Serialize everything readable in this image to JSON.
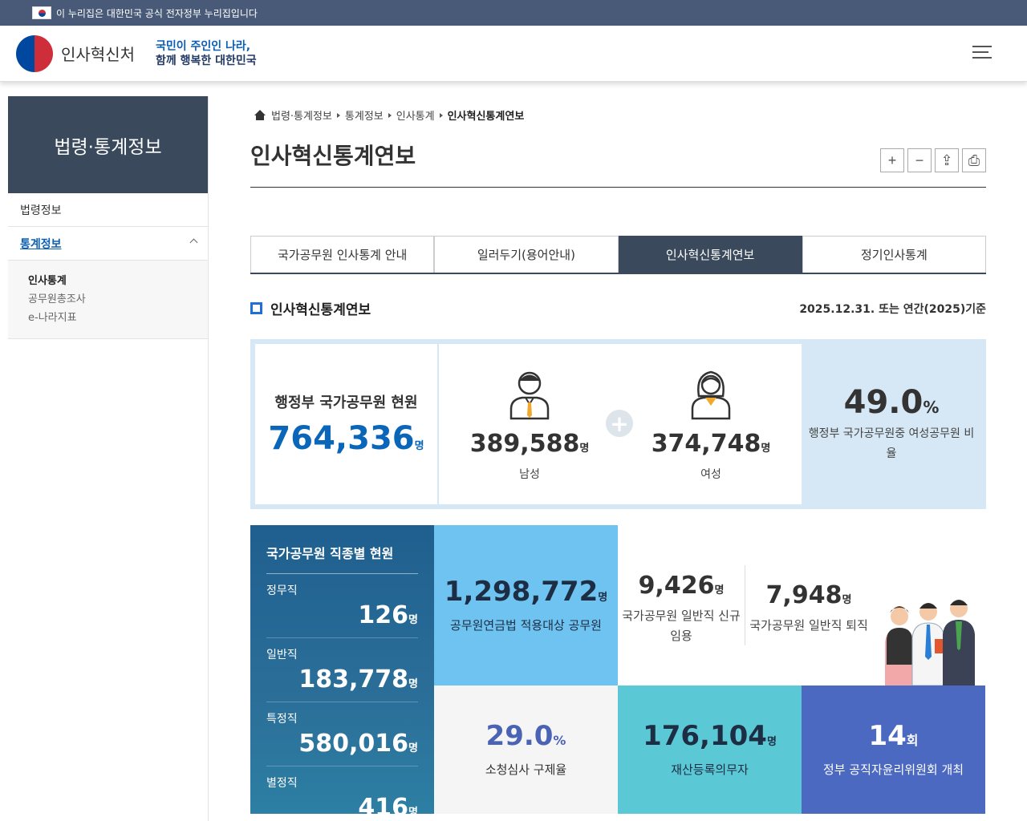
{
  "gov_banner": {
    "text": "이 누리집은 대한민국 공식 전자정부 누리집입니다"
  },
  "header": {
    "org_name": "인사혁신처",
    "slogan_line1": "국민이 주인인 나라,",
    "slogan_line2": "함께 행복한 대한민국"
  },
  "sidebar": {
    "title": "법령·통계정보",
    "items": [
      {
        "label": "법령정보"
      },
      {
        "label": "통계정보"
      }
    ],
    "sub_items": [
      {
        "label": "인사통계"
      },
      {
        "label": "공무원총조사"
      },
      {
        "label": "e-나라지표"
      }
    ]
  },
  "breadcrumb": [
    "법령·통계정보",
    "통계정보",
    "인사통계",
    "인사혁신통계연보"
  ],
  "page_title": "인사혁신통계연보",
  "tools": {
    "zoom_in": "+",
    "zoom_out": "−",
    "share": "⇪",
    "print": "⎙"
  },
  "tabs": [
    {
      "label": "국가공무원 인사통계 안내"
    },
    {
      "label": "일러두기(용어안내)"
    },
    {
      "label": "인사혁신통계연보",
      "active": true
    },
    {
      "label": "정기인사통계"
    }
  ],
  "section": {
    "title": "인사혁신통계연보",
    "date": "2025.12.31. 또는 연간(2025)기준"
  },
  "summary": {
    "total_label": "행정부 국가공무원 현원",
    "total_value": "764,336",
    "unit_person": "명",
    "male_value": "389,588",
    "male_label": "남성",
    "female_value": "374,748",
    "female_label": "여성",
    "plus": "+",
    "ratio_value": "49.0",
    "ratio_unit": "%",
    "ratio_label": "행정부 국가공무원중 여성공무원 비율"
  },
  "kinds": {
    "head": "국가공무원 직종별 현원",
    "rows": [
      {
        "label": "정무직",
        "value": "126"
      },
      {
        "label": "일반직",
        "value": "183,778"
      },
      {
        "label": "특정직",
        "value": "580,016"
      },
      {
        "label": "별정직",
        "value": "416"
      }
    ]
  },
  "tiles": {
    "pension_value": "1,298,772",
    "pension_label": "공무원연금법 적용대상 공무원",
    "hire_value": "9,426",
    "hire_label": "국가공무원 일반직 신규임용",
    "retire_value": "7,948",
    "retire_label": "국가공무원 일반직 퇴직",
    "appeal_value": "29.0",
    "appeal_unit": "%",
    "appeal_label": "소청심사 구제율",
    "asset_value": "176,104",
    "asset_label": "재산등록의무자",
    "ethics_value": "14",
    "ethics_unit": "회",
    "ethics_label": "정부 공직자윤리위원회 개최"
  },
  "colors": {
    "accent": "#0a66b8",
    "nav_dark": "#3a4a5c",
    "gov_bar": "#485a78"
  }
}
